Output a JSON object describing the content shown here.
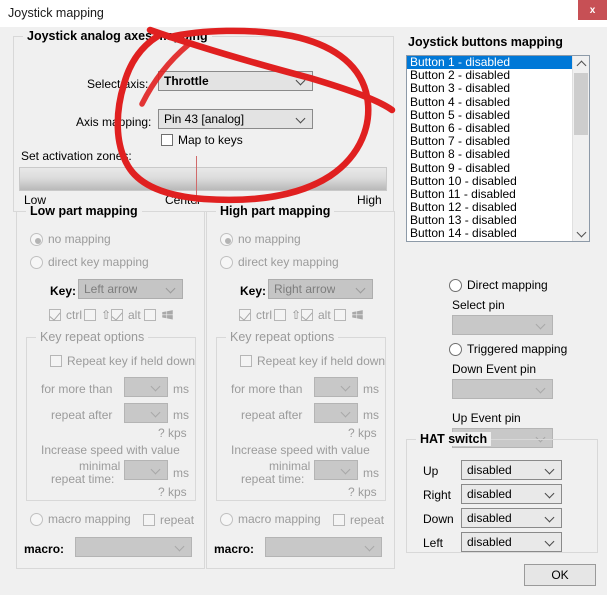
{
  "window": {
    "title": "Joystick mapping",
    "close_label": "x",
    "close_color": "#c75055"
  },
  "analog": {
    "group_title": "Joystick analog axes mapping",
    "select_axis_label": "Select axis:",
    "select_axis_value": "Throttle",
    "axis_mapping_label": "Axis mapping:",
    "axis_mapping_value": "Pin 43 [analog]",
    "map_to_keys_label": "Map to keys",
    "map_to_keys_checked": false,
    "zones_label": "Set activation zones:",
    "zone_low": "Low",
    "zone_center": "Center",
    "zone_high": "High",
    "zone_marker_color": "#d06a6a"
  },
  "low_part": {
    "group_title": "Low part mapping",
    "no_mapping_label": "no mapping",
    "no_mapping_selected": true,
    "direct_key_mapping_label": "direct key mapping",
    "direct_key_mapping_selected": false,
    "key_label": "Key:",
    "key_value": "Left arrow",
    "modifiers": [
      {
        "name": "ctrl",
        "label": "ctrl",
        "checked": true
      },
      {
        "name": "shift",
        "label": "",
        "checked": false
      },
      {
        "name": "alt",
        "label": "alt",
        "checked": true
      },
      {
        "name": "win",
        "label": "",
        "checked": false
      }
    ],
    "repeat_group_title": "Key repeat options",
    "repeat_held_label": "Repeat key if held down",
    "repeat_held_checked": false,
    "for_more_than_label": "for more than",
    "for_more_than_value": "",
    "ms_label": "ms",
    "repeat_after_label": "repeat after",
    "repeat_after_value": "",
    "kps_label": "? kps",
    "increase_speed_label": "Increase speed with value",
    "minimal_label": "minimal",
    "repeat_time_label": "repeat time:",
    "repeat_time_value": "",
    "macro_mapping_label": "macro mapping",
    "macro_mapping_selected": false,
    "repeat_label": "repeat",
    "repeat_checked": false,
    "macro_label": "macro:",
    "macro_value": ""
  },
  "high_part": {
    "group_title": "High part mapping",
    "no_mapping_label": "no mapping",
    "no_mapping_selected": true,
    "direct_key_mapping_label": "direct key mapping",
    "direct_key_mapping_selected": false,
    "key_label": "Key:",
    "key_value": "Right arrow",
    "modifiers": [
      {
        "name": "ctrl",
        "label": "ctrl",
        "checked": true
      },
      {
        "name": "shift",
        "label": "",
        "checked": false
      },
      {
        "name": "alt",
        "label": "alt",
        "checked": true
      },
      {
        "name": "win",
        "label": "",
        "checked": false
      }
    ],
    "repeat_group_title": "Key repeat options",
    "repeat_held_label": "Repeat key if held down",
    "repeat_held_checked": false,
    "for_more_than_label": "for more than",
    "for_more_than_value": "",
    "ms_label": "ms",
    "repeat_after_label": "repeat after",
    "repeat_after_value": "",
    "kps_label": "? kps",
    "increase_speed_label": "Increase speed with value",
    "minimal_label": "minimal",
    "repeat_time_label": "repeat time:",
    "repeat_time_value": "",
    "macro_mapping_label": "macro mapping",
    "macro_mapping_selected": false,
    "repeat_label": "repeat",
    "repeat_checked": false,
    "macro_label": "macro:",
    "macro_value": ""
  },
  "buttons_panel": {
    "group_title": "Joystick buttons mapping",
    "selected_index": 0,
    "items": [
      "Button 1 - disabled",
      "Button 2 - disabled",
      "Button 3 - disabled",
      "Button 4 - disabled",
      "Button 5 - disabled",
      "Button 6 - disabled",
      "Button 7 - disabled",
      "Button 8 - disabled",
      "Button 9 - disabled",
      "Button 10 - disabled",
      "Button 11 - disabled",
      "Button 12 - disabled",
      "Button 13 - disabled",
      "Button 14 - disabled"
    ],
    "selection_color": "#0078d7",
    "direct_mapping_label": "Direct mapping",
    "direct_mapping_selected": false,
    "select_pin_label": "Select pin",
    "select_pin_value": "",
    "triggered_mapping_label": "Triggered mapping",
    "triggered_mapping_selected": false,
    "down_event_pin_label": "Down Event pin",
    "down_event_pin_value": "",
    "up_event_pin_label": "Up Event pin",
    "up_event_pin_value": ""
  },
  "hat": {
    "group_title": "HAT switch",
    "rows": [
      {
        "label": "Up",
        "value": "disabled"
      },
      {
        "label": "Right",
        "value": "disabled"
      },
      {
        "label": "Down",
        "value": "disabled"
      },
      {
        "label": "Left",
        "value": "disabled"
      }
    ]
  },
  "footer": {
    "ok_label": "OK"
  },
  "annotation": {
    "color": "#e02020",
    "shape": "hand-drawn-ellipse"
  }
}
